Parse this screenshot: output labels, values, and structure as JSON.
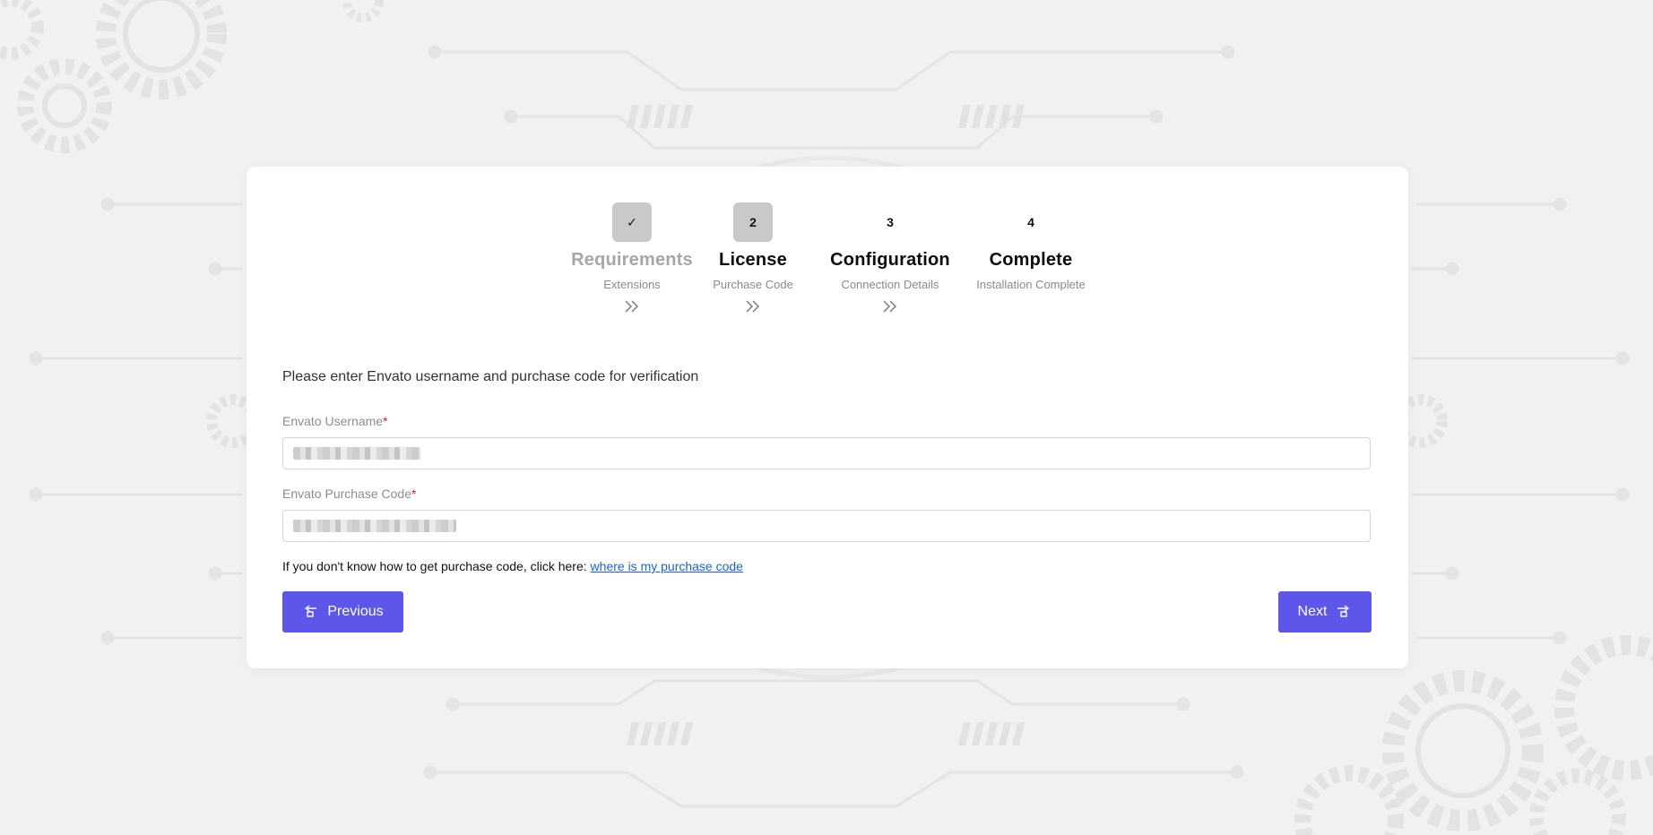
{
  "steps": [
    {
      "badge": "✓",
      "title": "Requirements",
      "subtitle": "Extensions",
      "status": "done"
    },
    {
      "badge": "2",
      "title": "License",
      "subtitle": "Purchase Code",
      "status": "current"
    },
    {
      "badge": "3",
      "title": "Configuration",
      "subtitle": "Connection Details",
      "status": "upcoming"
    },
    {
      "badge": "4",
      "title": "Complete",
      "subtitle": "Installation Complete",
      "status": "upcoming"
    }
  ],
  "form": {
    "intro": "Please enter Envato username and purchase code for verification",
    "username_label": "Envato Username",
    "purchase_code_label": "Envato Purchase Code",
    "required_mark": "*",
    "help_text": "If you don't know how to get purchase code, click here: ",
    "help_link": "where is my purchase code"
  },
  "buttons": {
    "previous_label": "Previous",
    "next_label": "Next",
    "previous_icon": "hand-pointing-left-icon",
    "next_icon": "hand-pointing-right-icon"
  },
  "colors": {
    "accent": "#5e55ea",
    "link": "#1565d8",
    "required": "#e02424",
    "badge_fill": "#c9c9cb"
  }
}
